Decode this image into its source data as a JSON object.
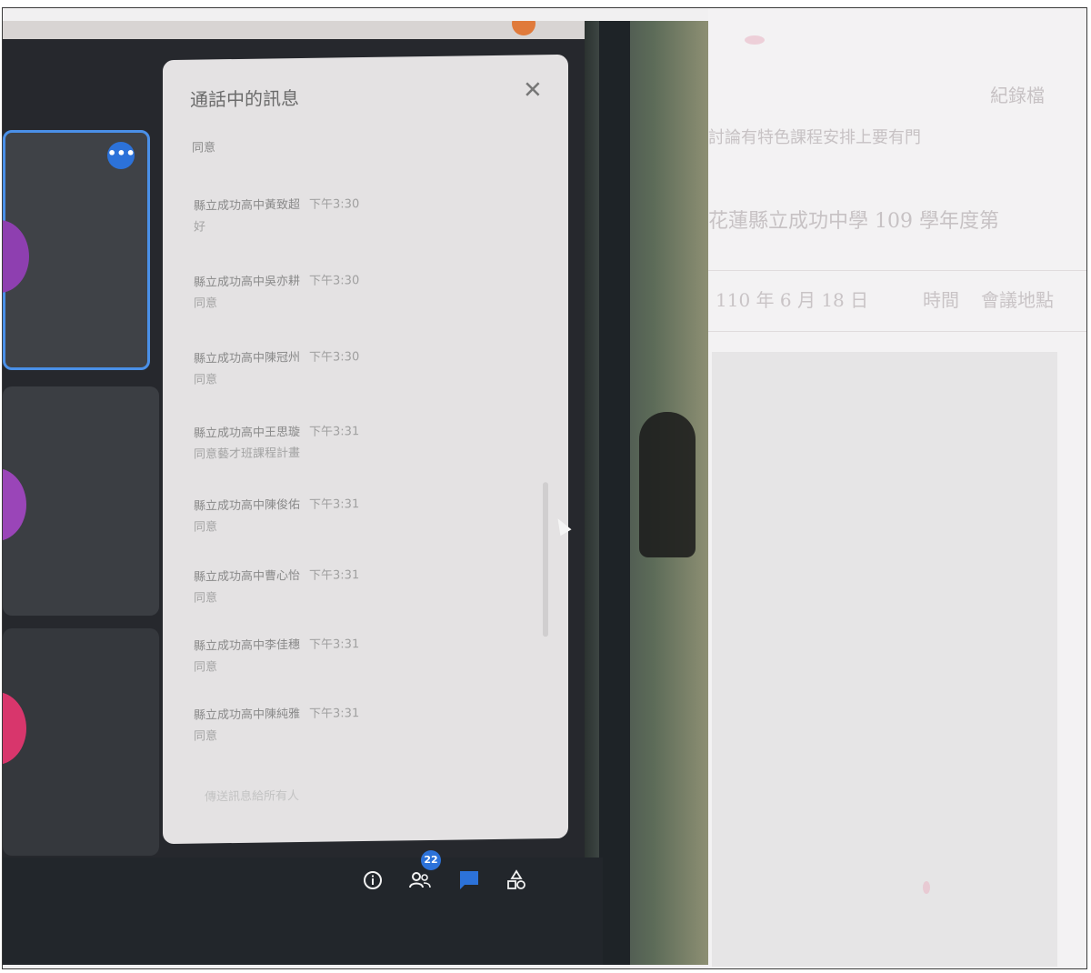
{
  "chat": {
    "title": "通話中的訊息",
    "close_icon": "close-icon",
    "intro": "同意",
    "messages": [
      {
        "sender": "縣立成功高中黃致超",
        "time": "下午3:30",
        "text": "好"
      },
      {
        "sender": "縣立成功高中吳亦耕",
        "time": "下午3:30",
        "text": "同意"
      },
      {
        "sender": "縣立成功高中陳冠州",
        "time": "下午3:30",
        "text": "同意"
      },
      {
        "sender": "縣立成功高中王思璇",
        "time": "下午3:31",
        "text": "同意藝才班課程計畫"
      },
      {
        "sender": "縣立成功高中陳俊佑",
        "time": "下午3:31",
        "text": "同意"
      },
      {
        "sender": "縣立成功高中曹心怡",
        "time": "下午3:31",
        "text": "同意"
      },
      {
        "sender": "縣立成功高中李佳穗",
        "time": "下午3:31",
        "text": "同意"
      },
      {
        "sender": "縣立成功高中陳純雅",
        "time": "下午3:31",
        "text": "同意"
      }
    ],
    "input_placeholder": "傳送訊息給所有人"
  },
  "tiles": {
    "more_icon_label": "•••"
  },
  "toolbar": {
    "icons": [
      "info-icon",
      "people-icon",
      "chat-icon",
      "activities-icon"
    ],
    "participants_count": "22"
  },
  "document": {
    "line1": "紀錄檔",
    "line2": "討論有特色課程安排上要有門",
    "line3": "花蓮縣立成功中學 109 學年度第",
    "table": [
      "110 年 6 月 18 日",
      "時間",
      "會議地點"
    ]
  },
  "colors": {
    "accent": "#2c72d9",
    "tile_highlight": "#4a90e8",
    "avatar_1": "#8e3fb0",
    "avatar_2": "#9a45b8",
    "avatar_3": "#d8366c"
  }
}
